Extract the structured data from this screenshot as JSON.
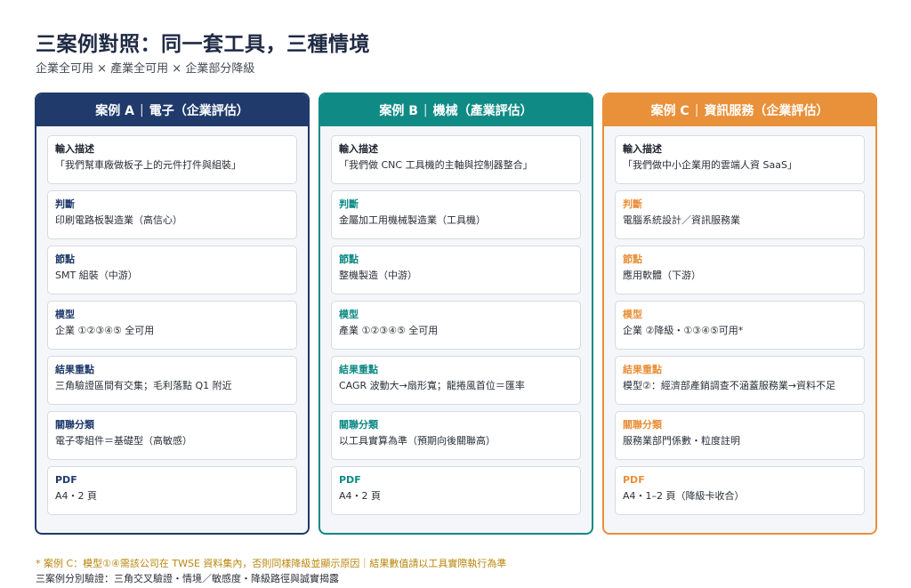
{
  "title": "三案例對照：同一套工具，三種情境",
  "subtitle": "企業全可用 × 產業全可用 × 企業部分降級",
  "colors": {
    "case_a": "#1f3a6b",
    "case_b": "#0f8a85",
    "case_c": "#e8903a"
  },
  "cases": [
    {
      "header_left": "案例 A",
      "header_sep": "|",
      "header_right": "電子（企業評估）",
      "cards": [
        {
          "label": "輸入描述",
          "value": "「我們幫車廠做板子上的元件打件與組裝」"
        },
        {
          "label": "判斷",
          "value": "印刷電路板製造業（高信心）"
        },
        {
          "label": "節點",
          "value": "SMT 組裝（中游）"
        },
        {
          "label": "模型",
          "value": "企業 ①②③④⑤ 全可用"
        },
        {
          "label": "結果重點",
          "value": "三角驗證區間有交集；毛利落點 Q1 附近"
        },
        {
          "label": "關聯分類",
          "value": "電子零組件＝基礎型（高敏感）"
        },
        {
          "label": "PDF",
          "value": "A4・2 頁"
        }
      ]
    },
    {
      "header_left": "案例 B",
      "header_sep": "|",
      "header_right": "機械（產業評估）",
      "cards": [
        {
          "label": "輸入描述",
          "value": "「我們做 CNC 工具機的主軸與控制器整合」"
        },
        {
          "label": "判斷",
          "value": "金屬加工用機械製造業（工具機）"
        },
        {
          "label": "節點",
          "value": "整機製造（中游）"
        },
        {
          "label": "模型",
          "value": "產業 ①②③④⑤ 全可用"
        },
        {
          "label": "結果重點",
          "value": "CAGR 波動大→扇形寬；龍捲風首位＝匯率"
        },
        {
          "label": "關聯分類",
          "value": "以工具實算為準（預期向後關聯高）"
        },
        {
          "label": "PDF",
          "value": "A4・2 頁"
        }
      ]
    },
    {
      "header_left": "案例 C",
      "header_sep": "|",
      "header_right": "資訊服務（企業評估）",
      "cards": [
        {
          "label": "輸入描述",
          "value": "「我們做中小企業用的雲端人資 SaaS」"
        },
        {
          "label": "判斷",
          "value": "電腦系統設計／資訊服務業"
        },
        {
          "label": "節點",
          "value": "應用軟體（下游）"
        },
        {
          "label": "模型",
          "value": "企業 ②降級・①③④⑤可用*"
        },
        {
          "label": "結果重點",
          "value": "模型②：經濟部產銷調查不涵蓋服務業→資料不足"
        },
        {
          "label": "關聯分類",
          "value": "服務業部門係數・粒度註明"
        },
        {
          "label": "PDF",
          "value": "A4・1–2 頁（降級卡收合）"
        }
      ]
    }
  ],
  "footnote": "* 案例 C：模型①④需該公司在 TWSE 資料集內，否則同樣降級並顯示原因｜結果數值請以工具實際執行為準",
  "footer": "三案例分別驗證：三角交叉驗證・情境／敏感度・降級路徑與誠實揭露"
}
